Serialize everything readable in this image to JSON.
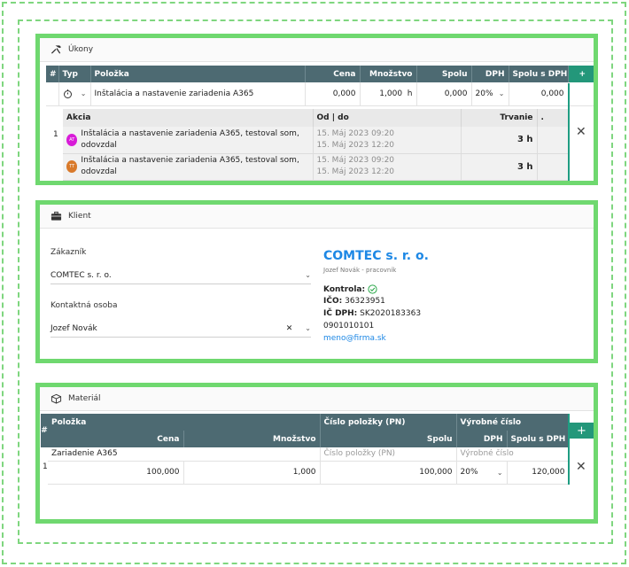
{
  "ukony": {
    "title": "Úkony",
    "headers": {
      "num": "#",
      "typ": "Typ",
      "polozka": "Položka",
      "cena": "Cena",
      "mnozstvo": "Množstvo",
      "spolu": "Spolu",
      "dph": "DPH",
      "spolu_dph": "Spolu s DPH",
      "add": "+"
    },
    "row": {
      "name": "Inštalácia a nastavenie zariadenia A365",
      "cena": "0,000",
      "mnozstvo": "1,000",
      "unit": "h",
      "spolu": "0,000",
      "dph": "20%",
      "spolu_dph": "0,000",
      "index": "1"
    },
    "sub_headers": {
      "akcia": "Akcia",
      "od_do": "Od | do",
      "trvanie": "Trvanie",
      "dot": "."
    },
    "actions": [
      {
        "avatar": "AT",
        "avatar_color": "#d81bd8",
        "text": "Inštalácia a nastavenie zariadenia A365, testoval som, odovzdal",
        "od": "15. Máj 2023 09:20",
        "do": "15. Máj 2023 12:20",
        "duration": "3 h"
      },
      {
        "avatar": "TT",
        "avatar_color": "#d97a2b",
        "text": "Inštalácia a nastavenie zariadenia A365, testoval som, odovzdal",
        "od": "15. Máj 2023 09:20",
        "do": "15. Máj 2023 12:20",
        "duration": "3 h"
      }
    ],
    "close": "✕"
  },
  "klient": {
    "title": "Klient",
    "zakaznik_label": "Zákazník",
    "zakaznik_value": "COMTEC s. r. o.",
    "kontakt_label": "Kontaktná osoba",
    "kontakt_value": "Jozef Novák",
    "clear": "✕",
    "company": "COMTEC s. r. o.",
    "role": "Jozef Novák - pracovník",
    "kontrola_label": "Kontrola:",
    "ico_label": "IČO:",
    "ico": "36323951",
    "icdph_label": "IČ DPH:",
    "icdph": "SK2020183363",
    "phone": "0901010101",
    "email": "meno@firma.sk"
  },
  "material": {
    "title": "Materiál",
    "headers": {
      "num": "#",
      "polozka": "Položka",
      "cislo": "Číslo položky (PN)",
      "vyrobne": "Výrobné číslo",
      "cena": "Cena",
      "mnozstvo": "Množstvo",
      "spolu": "Spolu",
      "dph": "DPH",
      "spolu_dph": "Spolu s DPH",
      "add": "+"
    },
    "row": {
      "index": "1",
      "name": "Zariadenie A365",
      "cislo_ph": "Číslo položky (PN)",
      "vyrobne_ph": "Výrobné číslo",
      "cena": "100,000",
      "mnozstvo": "1,000",
      "spolu": "100,000",
      "dph": "20%",
      "spolu_dph": "120,000"
    },
    "close": "✕"
  },
  "colors": {
    "accent_green": "#6fd86f",
    "header_bg": "#4d6a72",
    "add_btn": "#23977a",
    "link_blue": "#1e88e5"
  }
}
